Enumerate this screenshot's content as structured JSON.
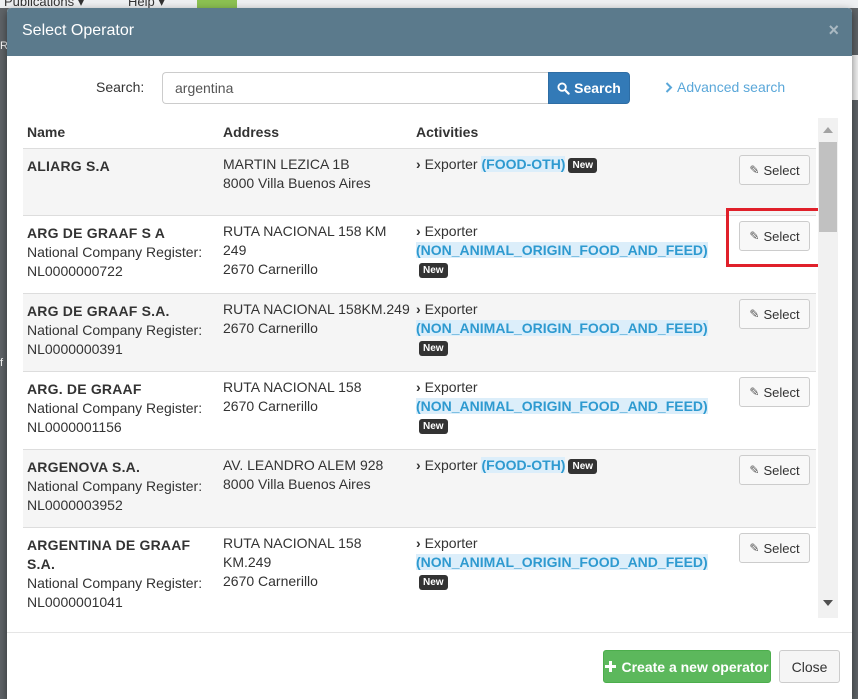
{
  "background": {
    "menu_publications": "Publications ▾",
    "menu_help": "Help ▾",
    "left_letter_1": "R",
    "left_letter_2": "f"
  },
  "modal": {
    "title": "Select Operator",
    "close_icon": "×"
  },
  "search": {
    "label": "Search:",
    "value": "argentina",
    "button_label": "Search",
    "advanced_label": "Advanced search"
  },
  "table": {
    "headers": {
      "name": "Name",
      "address": "Address",
      "activities": "Activities"
    },
    "select_label": "Select",
    "activity_label": "Exporter",
    "badge_label": "New",
    "rows": [
      {
        "name": "ALIARG S.A",
        "register": "",
        "address1": "MARTIN LEZICA 1B",
        "address2": "8000 Villa Buenos Aires",
        "code": "(FOOD-OTH)"
      },
      {
        "name": "ARG DE GRAAF S A",
        "register": "National Company Register: NL0000000722",
        "address1": "RUTA NACIONAL 158 KM 249",
        "address2": "2670 Carnerillo",
        "code": "(NON_ANIMAL_ORIGIN_FOOD_AND_FEED)"
      },
      {
        "name": "ARG DE GRAAF S.A.",
        "register": "National Company Register: NL0000000391",
        "address1": "RUTA NACIONAL 158KM.249",
        "address2": "2670 Carnerillo",
        "code": "(NON_ANIMAL_ORIGIN_FOOD_AND_FEED)"
      },
      {
        "name": "ARG. DE GRAAF",
        "register": "National Company Register: NL0000001156",
        "address1": "RUTA NACIONAL 158",
        "address2": "2670 Carnerillo",
        "code": "(NON_ANIMAL_ORIGIN_FOOD_AND_FEED)"
      },
      {
        "name": "ARGENOVA S.A.",
        "register": "National Company Register: NL0000003952",
        "address1": "AV. LEANDRO ALEM 928",
        "address2": "8000 Villa Buenos Aires",
        "code": "(FOOD-OTH)"
      },
      {
        "name": "ARGENTINA DE GRAAF S.A.",
        "register": "National Company Register: NL0000001041",
        "address1": "RUTA NACIONAL 158 KM.249",
        "address2": "2670 Carnerillo",
        "code": "(NON_ANIMAL_ORIGIN_FOOD_AND_FEED)"
      }
    ]
  },
  "footer": {
    "create_label": "Create a new operator",
    "close_label": "Close"
  },
  "colors": {
    "header": "#5b7a8c",
    "primary": "#337ab7",
    "success": "#5cb85c",
    "link": "#5aa7d9",
    "highlight": "#e0202a"
  }
}
